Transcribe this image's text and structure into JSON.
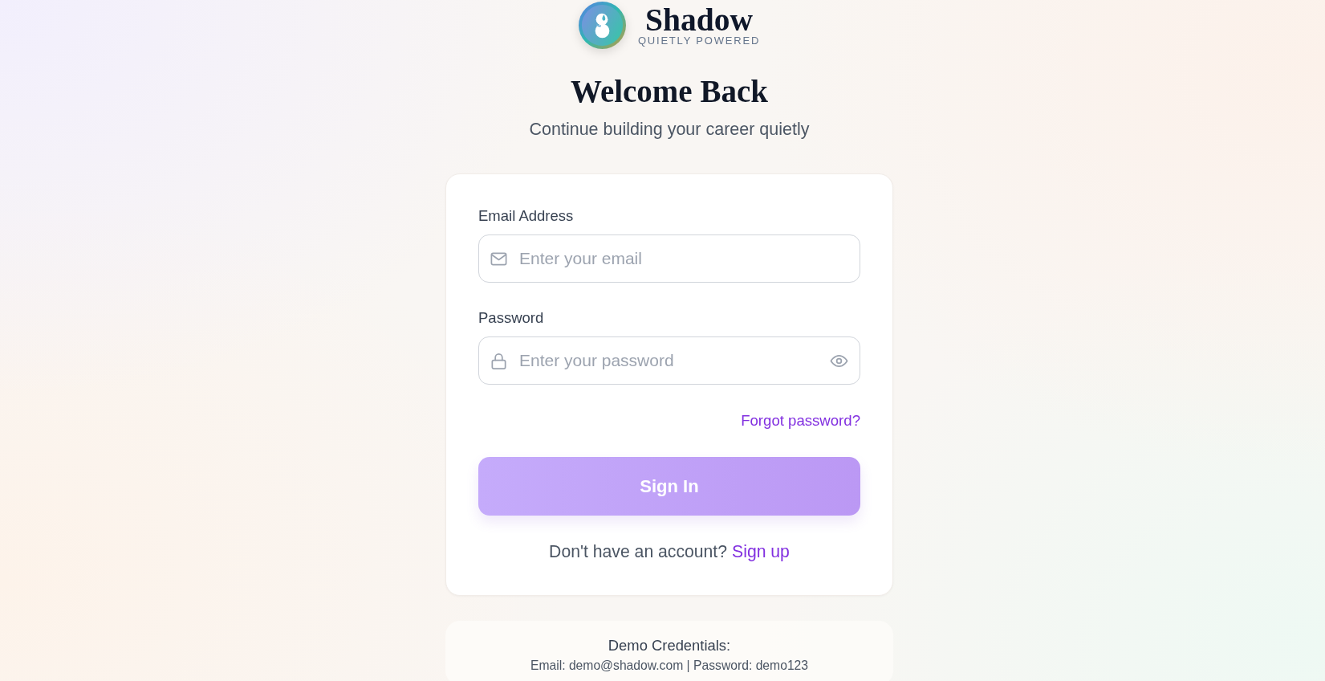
{
  "brand": {
    "name": "Shadow",
    "tagline": "QUIETLY POWERED"
  },
  "heading": {
    "title": "Welcome Back",
    "subtitle": "Continue building your career quietly"
  },
  "form": {
    "fields": [
      {
        "kind": "email",
        "label": "Email Address",
        "placeholder": "Enter your email"
      },
      {
        "kind": "password",
        "label": "Password",
        "placeholder": "Enter your password"
      }
    ],
    "forgot_link": "Forgot password?",
    "submit": "Sign In",
    "signup_prompt": "Don't have an account?",
    "signup_link": "Sign up"
  },
  "demo": {
    "title": "Demo Credentials:",
    "credentials": "Email: demo@shadow.com | Password: demo123"
  }
}
